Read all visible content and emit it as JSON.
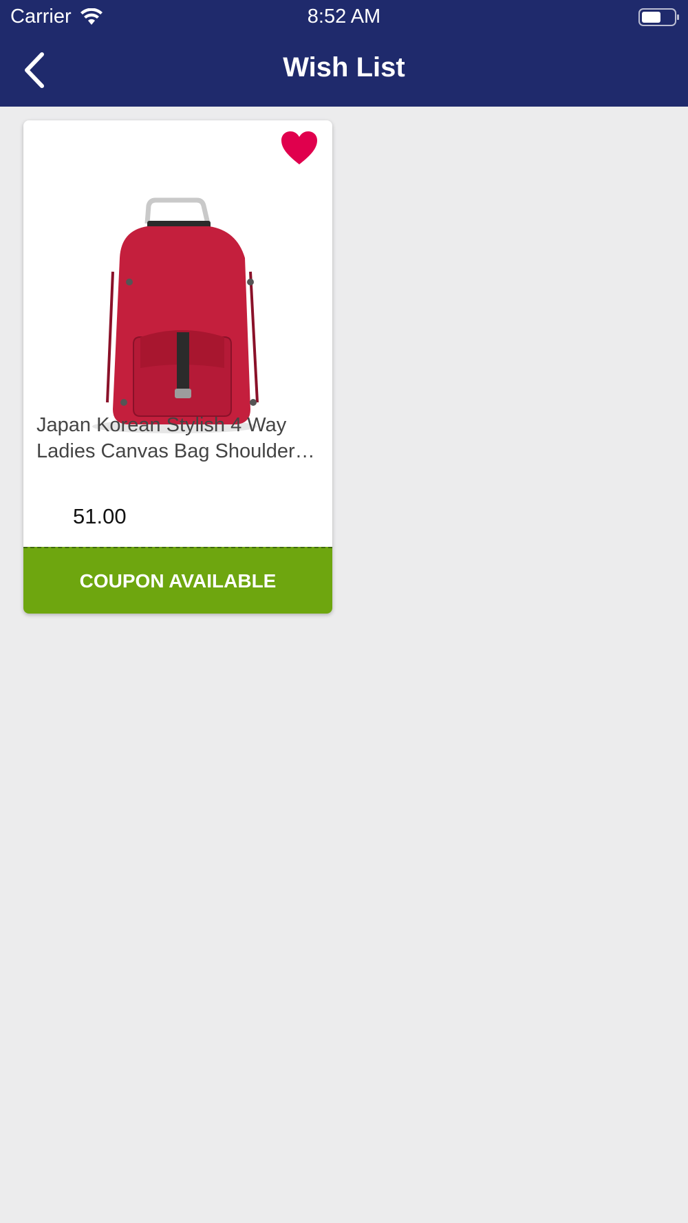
{
  "status_bar": {
    "carrier": "Carrier",
    "time": "8:52 AM"
  },
  "nav": {
    "title": "Wish List"
  },
  "colors": {
    "nav_background": "#1f2a6c",
    "page_background": "#ececed",
    "heart": "#e0004d",
    "coupon": "#6ea60f"
  },
  "items": [
    {
      "title": "Japan Korean Stylish 4 Way Ladies Canvas Bag Shoulder…",
      "price": "51.00",
      "coupon_label": "COUPON AVAILABLE",
      "image_icon": "red-canvas-backpack",
      "wishlisted": true
    }
  ]
}
